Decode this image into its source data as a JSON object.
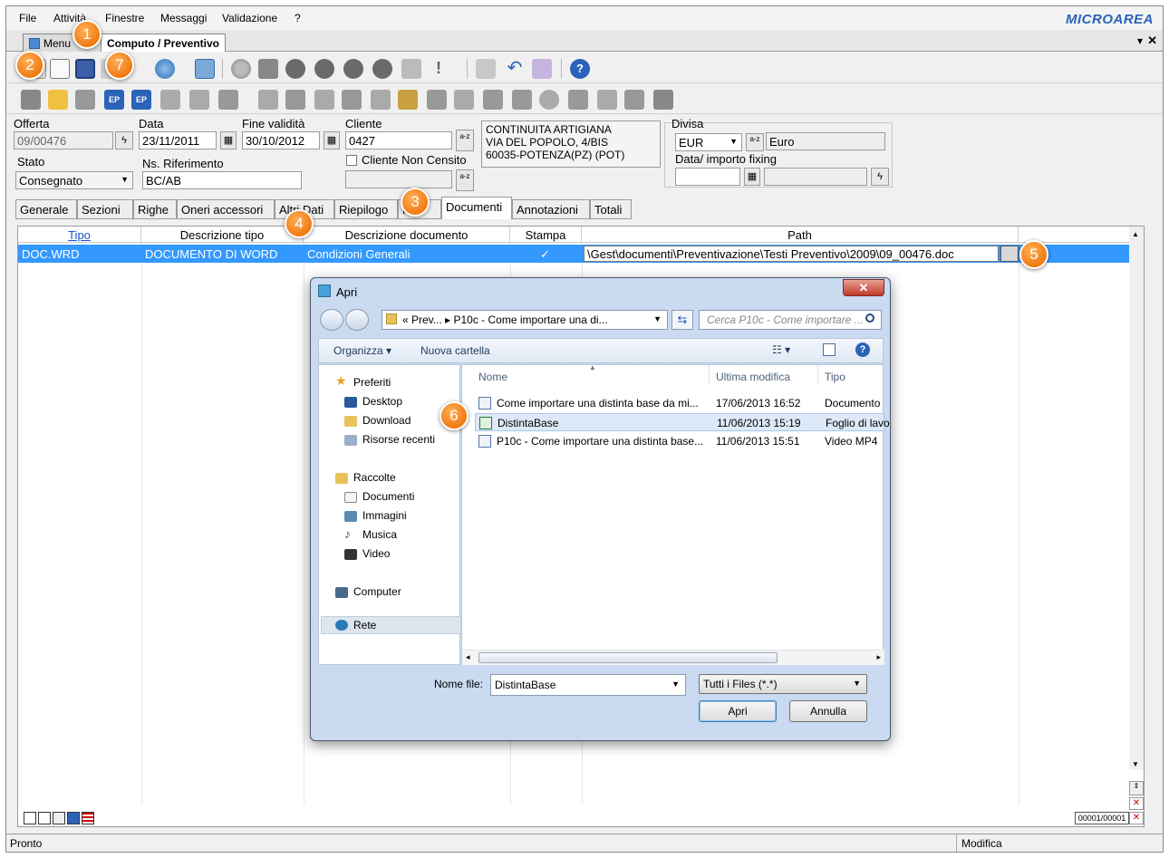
{
  "menu": {
    "items": [
      "File",
      "Attività",
      "Finestre",
      "Messaggi",
      "Validazione",
      "?"
    ],
    "logo": "MICROAREA"
  },
  "doc_tabs": {
    "menu": "Menu",
    "current": "Computo / Preventivo",
    "dropdown": "▾",
    "close": "✕"
  },
  "badges": [
    "1",
    "2",
    "3",
    "4",
    "5",
    "6",
    "7"
  ],
  "header": {
    "offerta_label": "Offerta",
    "offerta_value": "09/00476",
    "data_label": "Data",
    "data_value": "23/11/2011",
    "fine_label": "Fine validità",
    "fine_value": "30/10/2012",
    "cliente_label": "Cliente",
    "cliente_value": "0427",
    "address_lines": [
      "CONTINUITA ARTIGIANA",
      "VIA DEL POPOLO, 4/BIS",
      "60035-POTENZA(PZ) (POT)"
    ],
    "stato_label": "Stato",
    "stato_value": "Consegnato",
    "rif_label": "Ns. Riferimento",
    "rif_value": "BC/AB",
    "non_censito_label": "Cliente Non Censito",
    "divisa_label": "Divisa",
    "divisa_value": "EUR",
    "divisa_desc": "Euro",
    "fixing_label": "Data/ importo fixing",
    "az_label": "a-z"
  },
  "form_tabs": [
    "Generale",
    "Sezioni",
    "Righe",
    "Oneri accessori",
    "Altri Dati",
    "Riepilogo",
    "F",
    "Documenti",
    "Annotazioni",
    "Totali"
  ],
  "grid": {
    "headers": {
      "tipo": "Tipo",
      "desc_tipo": "Descrizione tipo",
      "desc_doc": "Descrizione documento",
      "stampa": "Stampa",
      "path": "Path"
    },
    "row": {
      "tipo": "DOC.WRD",
      "desc_tipo": "DOCUMENTO DI WORD",
      "desc_doc": "Condizioni Generali",
      "stampa": "✓",
      "path": "\\Gest\\documenti\\Preventivazione\\Testi Preventivo\\2009\\09_00476.doc"
    },
    "counter": "00001/00001"
  },
  "dialog": {
    "title": "Apri",
    "close": "✕",
    "address": "«  Prev...  ▸ P10c - Come importare una di...",
    "search_placeholder": "Cerca P10c - Come importare ...",
    "organizza": "Organizza ▾",
    "nuova_cartella": "Nuova cartella",
    "nav": {
      "preferiti": "Preferiti",
      "desktop": "Desktop",
      "download": "Download",
      "recenti": "Risorse recenti",
      "raccolte": "Raccolte",
      "documenti": "Documenti",
      "immagini": "Immagini",
      "musica": "Musica",
      "video": "Video",
      "computer": "Computer",
      "rete": "Rete"
    },
    "columns": {
      "nome": "Nome",
      "modifica": "Ultima modifica",
      "tipo": "Tipo"
    },
    "files": [
      {
        "name": "Come importare una distinta base da mi...",
        "date": "17/06/2013 16:52",
        "type": "Documento"
      },
      {
        "name": "DistintaBase",
        "date": "11/06/2013 15:19",
        "type": "Foglio di lavo"
      },
      {
        "name": "P10c - Come importare una distinta base...",
        "date": "11/06/2013 15:51",
        "type": "Video MP4"
      }
    ],
    "filename_label": "Nome file:",
    "filename_value": "DistintaBase",
    "filter_value": "Tutti i Files (*.*)",
    "open_button": "Apri",
    "cancel_button": "Annulla"
  },
  "status": {
    "left": "Pronto",
    "right": "Modifica"
  },
  "colors": {
    "selection": "#3399ff",
    "badge": "#f07a10",
    "logo": "#2a63b8"
  }
}
